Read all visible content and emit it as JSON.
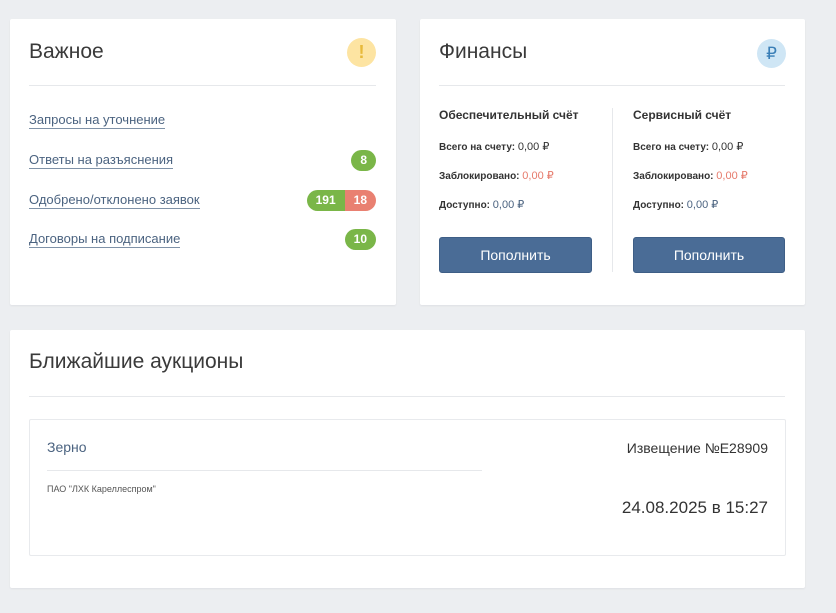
{
  "important": {
    "title": "Важное",
    "icon_glyph": "!",
    "items": [
      {
        "label": "Запросы на уточнение"
      },
      {
        "label": "Ответы на разъяснения",
        "count": "8"
      },
      {
        "label": "Одобрено/отклонено заявок",
        "approved": "191",
        "rejected": "18"
      },
      {
        "label": "Договоры на подписание",
        "count": "10"
      }
    ]
  },
  "finance": {
    "title": "Финансы",
    "icon_glyph": "₽",
    "accounts": [
      {
        "title": "Обеспечительный счёт",
        "total_label": "Всего на счету:",
        "total": "0,00 ₽",
        "blocked_label": "Заблокировано:",
        "blocked": "0,00 ₽",
        "available_label": "Доступно:",
        "available": "0,00 ₽",
        "button": "Пополнить"
      },
      {
        "title": "Сервисный счёт",
        "total_label": "Всего на счету:",
        "total": "0,00 ₽",
        "blocked_label": "Заблокировано:",
        "blocked": "0,00 ₽",
        "available_label": "Доступно:",
        "available": "0,00 ₽",
        "button": "Пополнить"
      }
    ]
  },
  "auctions": {
    "title": "Ближайшие аукционы",
    "items": [
      {
        "name": "Зерно",
        "org": "ПАО \"ЛХК Кареллеспром\"",
        "notice": "Извещение №E28909",
        "date": "24.08.2025 в 15:27"
      }
    ]
  },
  "colors": {
    "accent": "#4a6c96",
    "green": "#7ab648",
    "red": "#e98071",
    "link": "#4b6380"
  }
}
